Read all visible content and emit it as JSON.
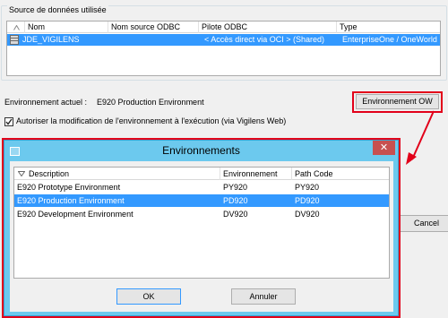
{
  "datasource": {
    "legend": "Source de données utilisée",
    "columns": [
      "Nom",
      "Nom source ODBC",
      "Pilote ODBC",
      "Type"
    ],
    "rows": [
      {
        "name": "JDE_VIGILENS",
        "odbc_source": "",
        "driver": "< Accès direct via OCI > (Shared)",
        "type": "EnterpriseOne / OneWorld"
      }
    ]
  },
  "environment": {
    "label": "Environnement actuel :",
    "value": "E920 Production Environment",
    "button_label": "Environnement OW"
  },
  "allow_change": {
    "label": "Autoriser la modification de l'environnement à l'exécution (via Vigilens Web)",
    "checked": true
  },
  "cancel_label": "Cancel",
  "modal": {
    "title": "Environnements",
    "columns": [
      "Description",
      "Environnement",
      "Path Code"
    ],
    "rows": [
      {
        "description": "E920 Prototype Environment",
        "environment": "PY920",
        "path_code": "PY920"
      },
      {
        "description": "E920 Production Environment",
        "environment": "PD920",
        "path_code": "PD920",
        "selected": true
      },
      {
        "description": "E920 Development Environment",
        "environment": "DV920",
        "path_code": "DV920"
      }
    ],
    "ok_label": "OK",
    "cancel_label": "Annuler"
  },
  "colors": {
    "selection": "#3399ff",
    "titlebar": "#6cc9ee",
    "highlight": "#e2001a",
    "close": "#c75050"
  }
}
